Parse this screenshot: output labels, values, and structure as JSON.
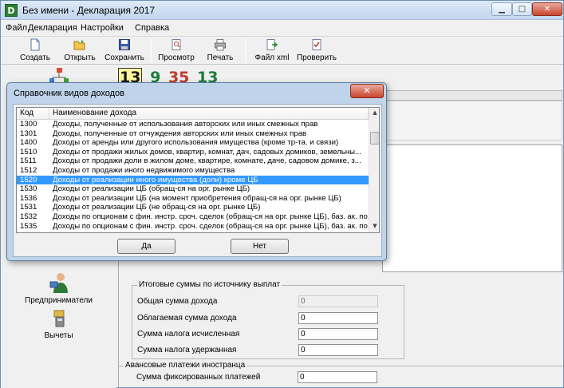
{
  "window": {
    "title": "Без имени - Декларация 2017",
    "app_icon_letter": "D",
    "controls": {
      "minimize": "▁",
      "maximize": "□",
      "close": "✕"
    }
  },
  "menu": [
    "Файл",
    "Декларация",
    "Настройки",
    "Справка"
  ],
  "toolbar": {
    "create": "Создать",
    "open": "Открыть",
    "save": "Сохранить",
    "preview": "Просмотр",
    "print": "Печать",
    "xml": "Файл xml",
    "check": "Проверить"
  },
  "rates": [
    "13",
    "9",
    "35",
    "13"
  ],
  "left_panel": {
    "entrepreneurs": "Предприниматели",
    "deductions": "Вычеты"
  },
  "totals": {
    "group_title": "Итоговые суммы по источнику выплат",
    "total_income_label": "Общая сумма дохода",
    "total_income_value": "0",
    "taxable_label": "Облагаемая сумма дохода",
    "taxable_value": "0",
    "tax_calc_label": "Сумма налога исчисленная",
    "tax_calc_value": "0",
    "tax_withheld_label": "Сумма налога удержанная",
    "tax_withheld_value": "0"
  },
  "advance": {
    "group_title": "Авансовые платежи иностранца",
    "fixed_label": "Сумма фиксированных платежей",
    "fixed_value": "0"
  },
  "dialog": {
    "title": "Справочник видов доходов",
    "close": "✕",
    "col_code": "Код",
    "col_name": "Наименование дохода",
    "rows": [
      {
        "code": "1300",
        "name": "Доходы, полученные от использования авторских или иных смежных прав"
      },
      {
        "code": "1301",
        "name": "Доходы, полученные от отчуждения авторских или иных смежных прав"
      },
      {
        "code": "1400",
        "name": "Доходы от аренды или другого использования имущества (кроме тр-та. и связи)"
      },
      {
        "code": "1510",
        "name": "Доходы от продажи жилых домов, квартир, комнат, дач, садовых домиков, земельны..."
      },
      {
        "code": "1511",
        "name": "Доходы от продажи доли в жилом доме, квартире, комнате, даче, садовом домике, з..."
      },
      {
        "code": "1512",
        "name": "Доходы от продажи иного недвижимого имущества"
      },
      {
        "code": "1520",
        "name": "Доходы от реализации иного имущества (доли) кроме ЦБ",
        "selected": true
      },
      {
        "code": "1530",
        "name": "Доходы от реализации ЦБ (обращ-ся на орг. рынке ЦБ)"
      },
      {
        "code": "1536",
        "name": "Доходы от реализации ЦБ (на момент приобретения обращ-ся на орг. рынке ЦБ)"
      },
      {
        "code": "1531",
        "name": "Доходы от реализации ЦБ (не обращ-ся на орг. рынке ЦБ)"
      },
      {
        "code": "1532",
        "name": "Доходы по опционам с фин. инстр. сроч. сделок (обращ-ся на орг. рынке ЦБ), баз. ак. по..."
      },
      {
        "code": "1535",
        "name": "Доходы по опционам с фин. инстр. сроч. сделок (обращ-ся на орг. рынке ЦБ), баз. ак. по..."
      }
    ],
    "yes": "Да",
    "no": "Нет"
  },
  "colors": {
    "selection": "#3399ff",
    "dialog_frame": "#bfd3ea",
    "close_button": "#c8452f"
  }
}
